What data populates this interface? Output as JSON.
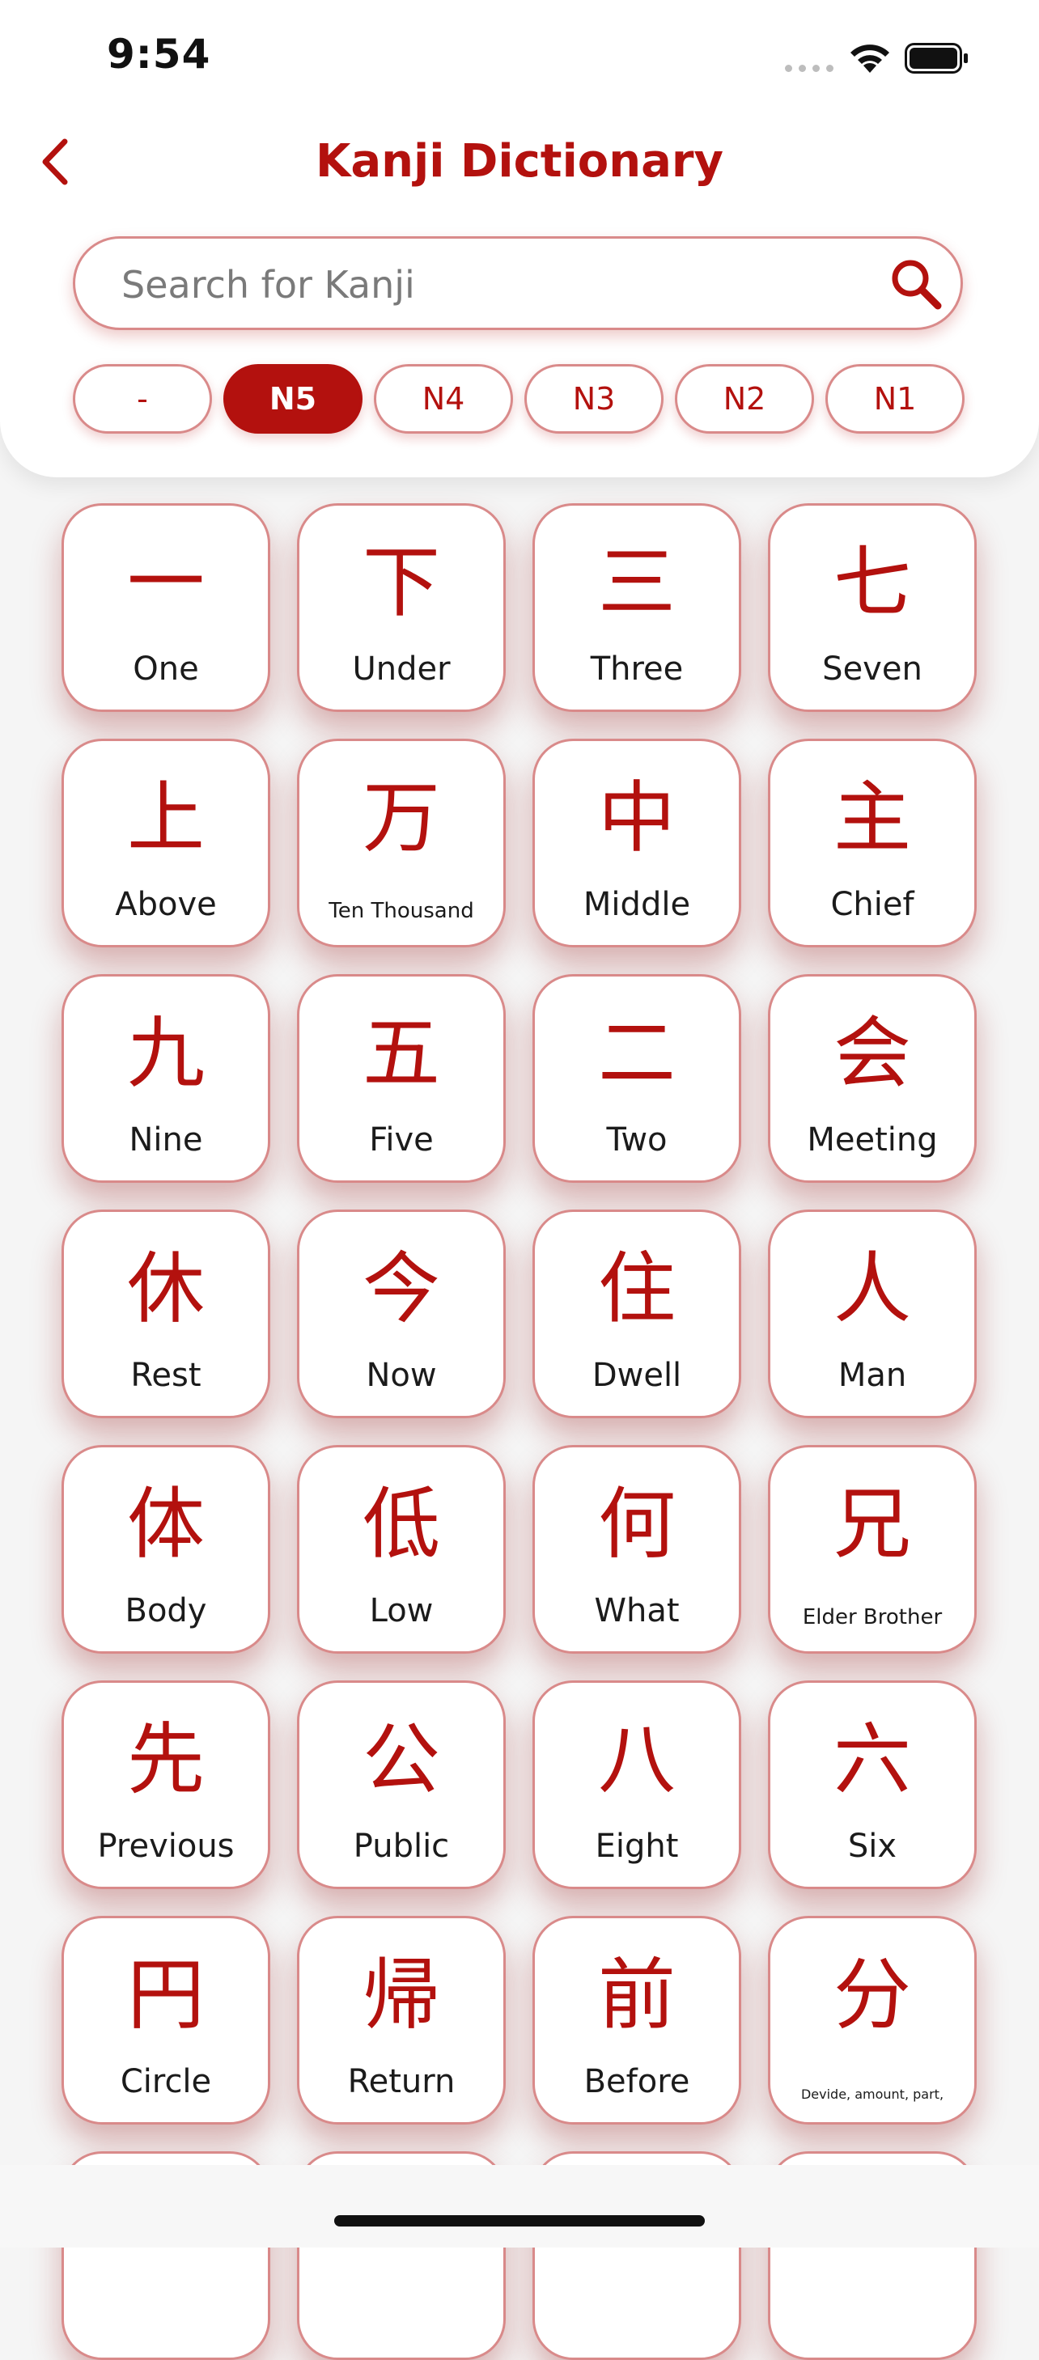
{
  "status_bar": {
    "time": "9:54"
  },
  "header": {
    "title": "Kanji Dictionary"
  },
  "search": {
    "placeholder": "Search for Kanji",
    "value": ""
  },
  "levels": [
    {
      "label": "-",
      "active": false
    },
    {
      "label": "N5",
      "active": true
    },
    {
      "label": "N4",
      "active": false
    },
    {
      "label": "N3",
      "active": false
    },
    {
      "label": "N2",
      "active": false
    },
    {
      "label": "N1",
      "active": false
    }
  ],
  "kanji_cards": [
    {
      "kanji": "一",
      "meaning": "One"
    },
    {
      "kanji": "下",
      "meaning": "Under"
    },
    {
      "kanji": "三",
      "meaning": "Three"
    },
    {
      "kanji": "七",
      "meaning": "Seven"
    },
    {
      "kanji": "上",
      "meaning": "Above"
    },
    {
      "kanji": "万",
      "meaning": "Ten Thousand"
    },
    {
      "kanji": "中",
      "meaning": "Middle"
    },
    {
      "kanji": "主",
      "meaning": "Chief"
    },
    {
      "kanji": "九",
      "meaning": "Nine"
    },
    {
      "kanji": "五",
      "meaning": "Five"
    },
    {
      "kanji": "二",
      "meaning": "Two"
    },
    {
      "kanji": "会",
      "meaning": "Meeting"
    },
    {
      "kanji": "休",
      "meaning": "Rest"
    },
    {
      "kanji": "今",
      "meaning": "Now"
    },
    {
      "kanji": "住",
      "meaning": "Dwell"
    },
    {
      "kanji": "人",
      "meaning": "Man"
    },
    {
      "kanji": "体",
      "meaning": "Body"
    },
    {
      "kanji": "低",
      "meaning": "Low"
    },
    {
      "kanji": "何",
      "meaning": "What"
    },
    {
      "kanji": "兄",
      "meaning": "Elder Brother"
    },
    {
      "kanji": "先",
      "meaning": "Previous"
    },
    {
      "kanji": "公",
      "meaning": "Public"
    },
    {
      "kanji": "八",
      "meaning": "Eight"
    },
    {
      "kanji": "六",
      "meaning": "Six"
    },
    {
      "kanji": "円",
      "meaning": "Circle"
    },
    {
      "kanji": "帰",
      "meaning": "Return"
    },
    {
      "kanji": "前",
      "meaning": "Before"
    },
    {
      "kanji": "分",
      "meaning": "Devide, amount, part,"
    }
  ],
  "colors": {
    "accent": "#b3110e",
    "card_border": "#d98a8a",
    "background": "#f5f5f5"
  }
}
